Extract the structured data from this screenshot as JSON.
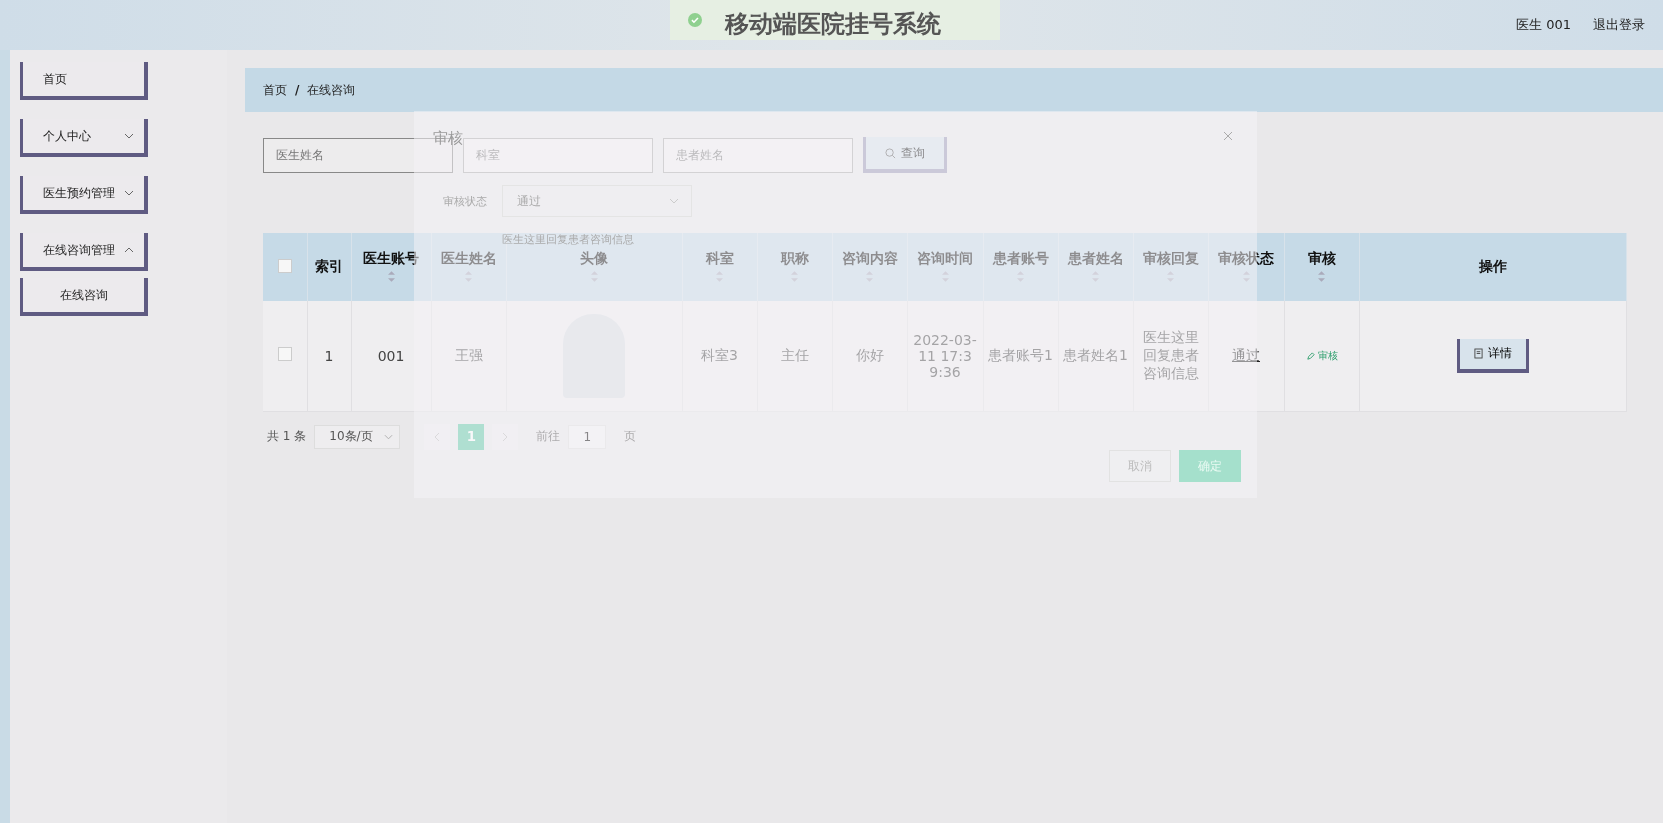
{
  "header": {
    "title": "移动端医院挂号系统",
    "user": "医生 001",
    "logout": "退出登录"
  },
  "sidebar": {
    "items": [
      {
        "label": "首页",
        "has_submenu": false
      },
      {
        "label": "个人中心",
        "has_submenu": true,
        "expanded": false
      },
      {
        "label": "医生预约管理",
        "has_submenu": true,
        "expanded": false
      },
      {
        "label": "在线咨询管理",
        "has_submenu": true,
        "expanded": true,
        "children": [
          {
            "label": "在线咨询"
          }
        ]
      }
    ]
  },
  "breadcrumb": {
    "items": [
      "首页",
      "在线咨询"
    ],
    "separator": "/"
  },
  "search": {
    "fields": [
      {
        "placeholder": "医生姓名"
      },
      {
        "placeholder": "科室"
      },
      {
        "placeholder": "患者姓名"
      }
    ],
    "button": "查询"
  },
  "table": {
    "select_all_checked": false,
    "columns": [
      {
        "kind": "check"
      },
      {
        "kind": "text",
        "label": "索引",
        "sortable": false
      },
      {
        "kind": "text",
        "label": "医生账号",
        "sortable": true
      },
      {
        "kind": "text",
        "label": "医生姓名",
        "sortable": true
      },
      {
        "kind": "photo",
        "label": "头像",
        "sortable": true
      },
      {
        "kind": "text",
        "label": "科室",
        "sortable": true
      },
      {
        "kind": "text",
        "label": "职称",
        "sortable": true
      },
      {
        "kind": "text",
        "label": "咨询内容",
        "sortable": true
      },
      {
        "kind": "text",
        "label": "咨询时间",
        "sortable": true
      },
      {
        "kind": "text",
        "label": "患者账号",
        "sortable": true
      },
      {
        "kind": "text",
        "label": "患者姓名",
        "sortable": true
      },
      {
        "kind": "text",
        "label": "审核回复",
        "sortable": true
      },
      {
        "kind": "status",
        "label": "审核状态",
        "sortable": true
      },
      {
        "kind": "link",
        "label": "审核",
        "sortable": true
      },
      {
        "kind": "button",
        "label": "操作",
        "sortable": false
      }
    ],
    "rows": [
      {
        "checked": false,
        "cells": [
          "",
          "1",
          "001",
          "王强",
          "",
          "科室3",
          "主任",
          "你好",
          "2022-03-11 17:39:36",
          "患者账号1",
          "患者姓名1",
          "医生这里回复患者咨询信息",
          "通过",
          "审核",
          "详情"
        ]
      }
    ]
  },
  "pagination": {
    "total": "共 1 条",
    "page_size": "10条/页",
    "pages": [
      {
        "label": "1",
        "selected": true
      }
    ],
    "goto_label": "前往",
    "goto_value": "1",
    "page_suffix": "页"
  },
  "dialog": {
    "title": "审核",
    "status_label": "审核状态",
    "status_value": "通过",
    "reply": "医生这里回复患者咨询信息",
    "buttons": [
      {
        "label": "取消",
        "kind": "secondary"
      },
      {
        "label": "确定",
        "kind": "primary"
      }
    ]
  }
}
